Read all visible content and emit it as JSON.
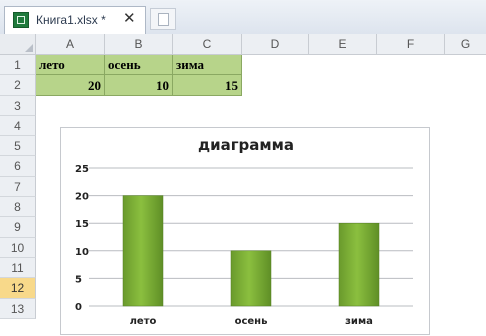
{
  "tab": {
    "title": "Книга1.xlsx *",
    "close_glyph": "✕",
    "icon": "excel-file-icon"
  },
  "columns": [
    "A",
    "B",
    "C",
    "D",
    "E",
    "F",
    "G"
  ],
  "rows": [
    "1",
    "2",
    "3",
    "4",
    "5",
    "6",
    "7",
    "8",
    "9",
    "10",
    "11",
    "12",
    "13"
  ],
  "active_row": "12",
  "cells": {
    "A1": "лето",
    "B1": "осень",
    "C1": "зима",
    "A2": "20",
    "B2": "10",
    "C2": "15"
  },
  "colors": {
    "cell_fill": "#b7d48a",
    "bar_fill": "#8bbf3f",
    "active_row": "#f8d98a"
  },
  "chart_data": {
    "type": "bar",
    "title": "диаграмма",
    "categories": [
      "лето",
      "осень",
      "зима"
    ],
    "values": [
      20,
      10,
      15
    ],
    "ylim": [
      0,
      25
    ],
    "yticks": [
      "0",
      "5",
      "10",
      "15",
      "20",
      "25"
    ],
    "grid": true
  }
}
